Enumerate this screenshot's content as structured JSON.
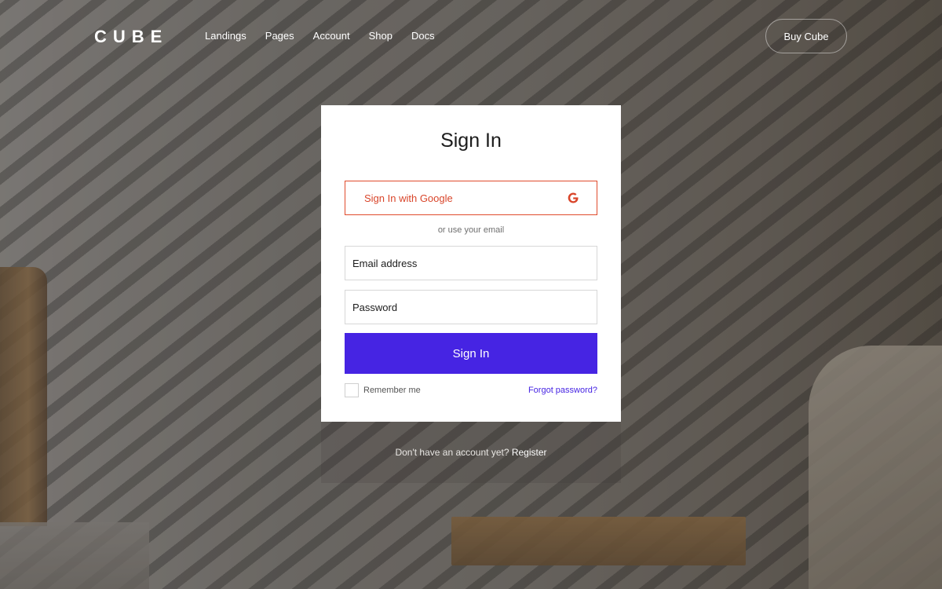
{
  "header": {
    "logo": "CUBE",
    "nav": [
      {
        "label": "Landings"
      },
      {
        "label": "Pages"
      },
      {
        "label": "Account"
      },
      {
        "label": "Shop"
      },
      {
        "label": "Docs"
      }
    ],
    "buy_label": "Buy Cube"
  },
  "card": {
    "title": "Sign In",
    "google_label": "Sign In with Google",
    "google_icon": "google-g-icon",
    "divider": "or use your email",
    "email_placeholder": "Email address",
    "password_placeholder": "Password",
    "submit_label": "Sign In",
    "remember_label": "Remember me",
    "forgot_label": "Forgot password?"
  },
  "register": {
    "prompt": "Don't have an account yet?",
    "link": "Register"
  },
  "colors": {
    "accent": "#4624e3",
    "google": "#e04b2c"
  }
}
